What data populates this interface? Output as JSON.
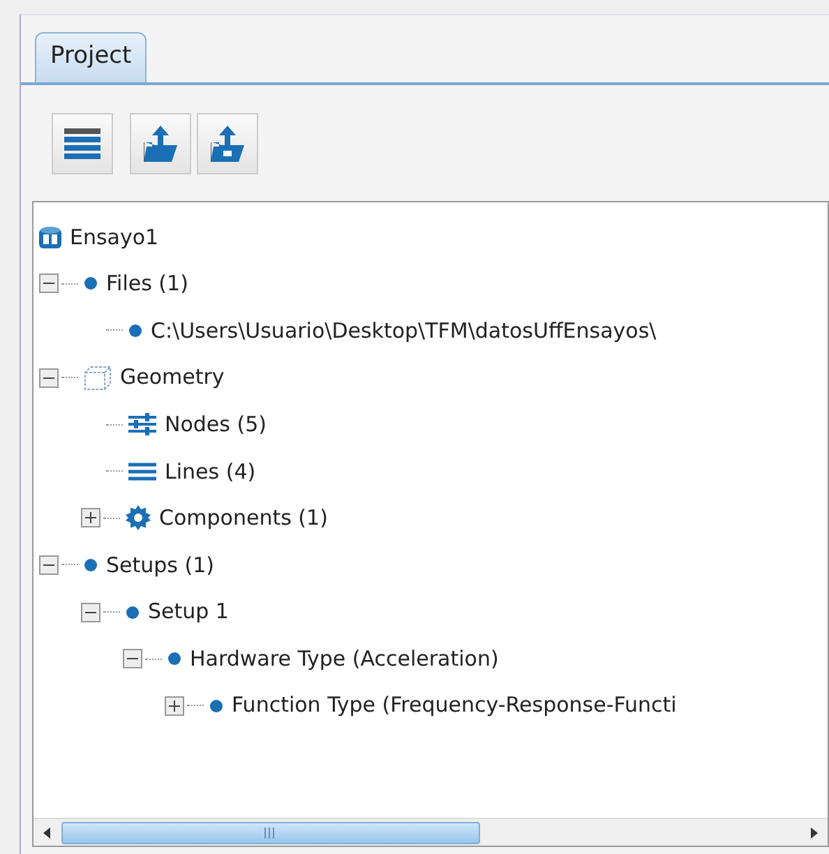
{
  "tabs": [
    {
      "label": "Project",
      "selected": true
    }
  ],
  "toolbar": [
    {
      "kind": "list"
    },
    {
      "kind": "upload"
    },
    {
      "kind": "upload-alt"
    }
  ],
  "tree": [
    {
      "label": "Ensayo1",
      "kind": "project",
      "children": [
        {
          "label": "Files (1)",
          "kind": "dot",
          "expanded": true,
          "children": [
            {
              "label": "C:\\Users\\Usuario\\Desktop\\TFM\\datosUffEnsayos\\",
              "kind": "dot"
            }
          ]
        },
        {
          "label": "Geometry",
          "kind": "geometry",
          "expanded": true,
          "children": [
            {
              "label": "Nodes (5)",
              "kind": "nodes"
            },
            {
              "label": "Lines (4)",
              "kind": "lines"
            },
            {
              "label": "Components (1)",
              "kind": "gear",
              "expanded": false
            }
          ]
        },
        {
          "label": "Setups (1)",
          "kind": "dot",
          "expanded": true,
          "children": [
            {
              "label": "Setup 1",
              "kind": "dot",
              "expanded": true,
              "children": [
                {
                  "label": "Hardware Type (Acceleration)",
                  "kind": "dot",
                  "expanded": true,
                  "children": [
                    {
                      "label": "Function Type (Frequency-Response-Functi",
                      "kind": "dot",
                      "expanded": false
                    }
                  ]
                }
              ]
            }
          ]
        }
      ]
    }
  ]
}
